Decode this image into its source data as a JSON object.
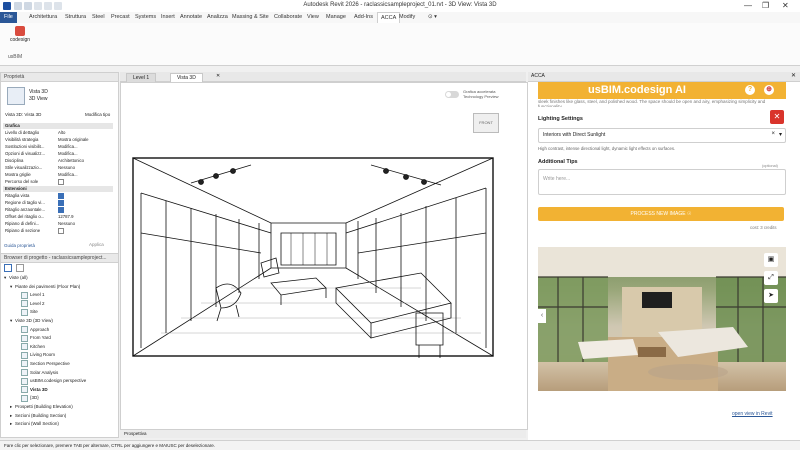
{
  "window": {
    "title": "Autodesk Revit 2026 - raclassicsampleproject_01.rvt - 3D View: Vista 3D",
    "controls": [
      "—",
      "❐",
      "✕"
    ]
  },
  "ribbon": {
    "tabs": [
      "File",
      "Architettura",
      "Struttura",
      "Steel",
      "Precast",
      "Systems",
      "Insert",
      "Annotate",
      "Analizza",
      "Massing & Site",
      "Collaborate",
      "View",
      "Manage",
      "Add-Ins",
      "ACCA",
      "Modify"
    ],
    "active_tab": "ACCA",
    "tool_label": "codesign",
    "panel_label": "usBIM"
  },
  "properties": {
    "header": "Proprietà",
    "type_name": "Vista 3D",
    "type_sub": "3D View",
    "selector_value": "Vista 3D: Vista 3D",
    "edit_type_label": "Modifica tipo",
    "rows": [
      {
        "k": "Grafica",
        "v": "",
        "group": true
      },
      {
        "k": "Livello di dettaglio",
        "v": "Alto"
      },
      {
        "k": "Visibilità strategia",
        "v": "Mostra originale"
      },
      {
        "k": "Sostituzioni visibilit...",
        "v": "Modifica..."
      },
      {
        "k": "Opzioni di visualizz...",
        "v": "Modifica..."
      },
      {
        "k": "Disciplina",
        "v": "Architettonico"
      },
      {
        "k": "Stile visualizzazio...",
        "v": "Nessuno"
      },
      {
        "k": "Mostra griglie",
        "v": "Modifica..."
      },
      {
        "k": "Percorso del sole",
        "v": "",
        "check": false
      },
      {
        "k": "Estensioni",
        "v": "",
        "group": true
      },
      {
        "k": "Ritaglia vista",
        "v": "",
        "check": true
      },
      {
        "k": "Regione di taglio vi...",
        "v": "",
        "check": true
      },
      {
        "k": "Ritaglio anzaontale...",
        "v": "",
        "check": true
      },
      {
        "k": "Offset del ritaglio o...",
        "v": "12787.9"
      },
      {
        "k": "Ripiano di defini...",
        "v": "Nessuno"
      },
      {
        "k": "Ripiano di sezione",
        "v": "",
        "check": false
      }
    ],
    "help_link": "Guida proprietà",
    "apply_label": "Applica"
  },
  "browser": {
    "header": "Browser di progetto - raclassicsampleproject...",
    "items": [
      {
        "label": "Viste (all)",
        "indent": 0,
        "arrow": "▾"
      },
      {
        "label": "Piante dei pavimenti (Floor Plan)",
        "indent": 1,
        "arrow": "▾"
      },
      {
        "label": "Level 1",
        "indent": 2,
        "arrow": ""
      },
      {
        "label": "Level 2",
        "indent": 2,
        "arrow": ""
      },
      {
        "label": "Site",
        "indent": 2,
        "arrow": ""
      },
      {
        "label": "Viste 3D (3D View)",
        "indent": 1,
        "arrow": "▾"
      },
      {
        "label": "Approach",
        "indent": 2,
        "arrow": ""
      },
      {
        "label": "From Yard",
        "indent": 2,
        "arrow": ""
      },
      {
        "label": "Kitchen",
        "indent": 2,
        "arrow": ""
      },
      {
        "label": "Living Room",
        "indent": 2,
        "arrow": ""
      },
      {
        "label": "Section Perspective",
        "indent": 2,
        "arrow": ""
      },
      {
        "label": "Solar Analysis",
        "indent": 2,
        "arrow": ""
      },
      {
        "label": "usBIM.codesign perspective",
        "indent": 2,
        "arrow": ""
      },
      {
        "label": "Vista 3D",
        "indent": 2,
        "arrow": "",
        "bold": true
      },
      {
        "label": "{3D}",
        "indent": 2,
        "arrow": ""
      },
      {
        "label": "Prospetti (Building Elevation)",
        "indent": 1,
        "arrow": "▸"
      },
      {
        "label": "Sezioni (Building Section)",
        "indent": 1,
        "arrow": "▸"
      },
      {
        "label": "Sezioni (Wall Section)",
        "indent": 1,
        "arrow": "▸"
      }
    ]
  },
  "view": {
    "tabs": [
      "Level 1",
      "Vista 3D"
    ],
    "active_tab": "Vista 3D",
    "toggle_label_1": "Grafica accelerata",
    "toggle_label_2": "Technology Preview",
    "viewcube_label": "FRONT",
    "status_label": "Prospettiva"
  },
  "statusbar": {
    "text": "Fare clic per selezionare, premere TAB per alternare, CTRL per aggiungere e MAIUSC per deselezionare."
  },
  "acca": {
    "header": "ACCA",
    "brand": "usBIM.codesign AI",
    "help_icon": "?",
    "intro_text": "sleek finishes like glass, steel, and polished wood. The space should be open and airy, emphasizing simplicity and functionality.",
    "lighting_title": "Lighting Settings",
    "lighting_value": "Interiors with Direct Sunlight",
    "lighting_desc": "High contrast, intense directional light, dynamic light effects on surfaces.",
    "tips_title": "Additional Tips",
    "tips_optional": "(optional)",
    "tips_placeholder": "Write here...",
    "process_label": "PROCESS NEW IMAGE ☉",
    "cost_label": "cost: 3 credits",
    "open_link": "open view in Revit",
    "colors": {
      "brand": "#f2b233",
      "close": "#d9342b"
    }
  }
}
